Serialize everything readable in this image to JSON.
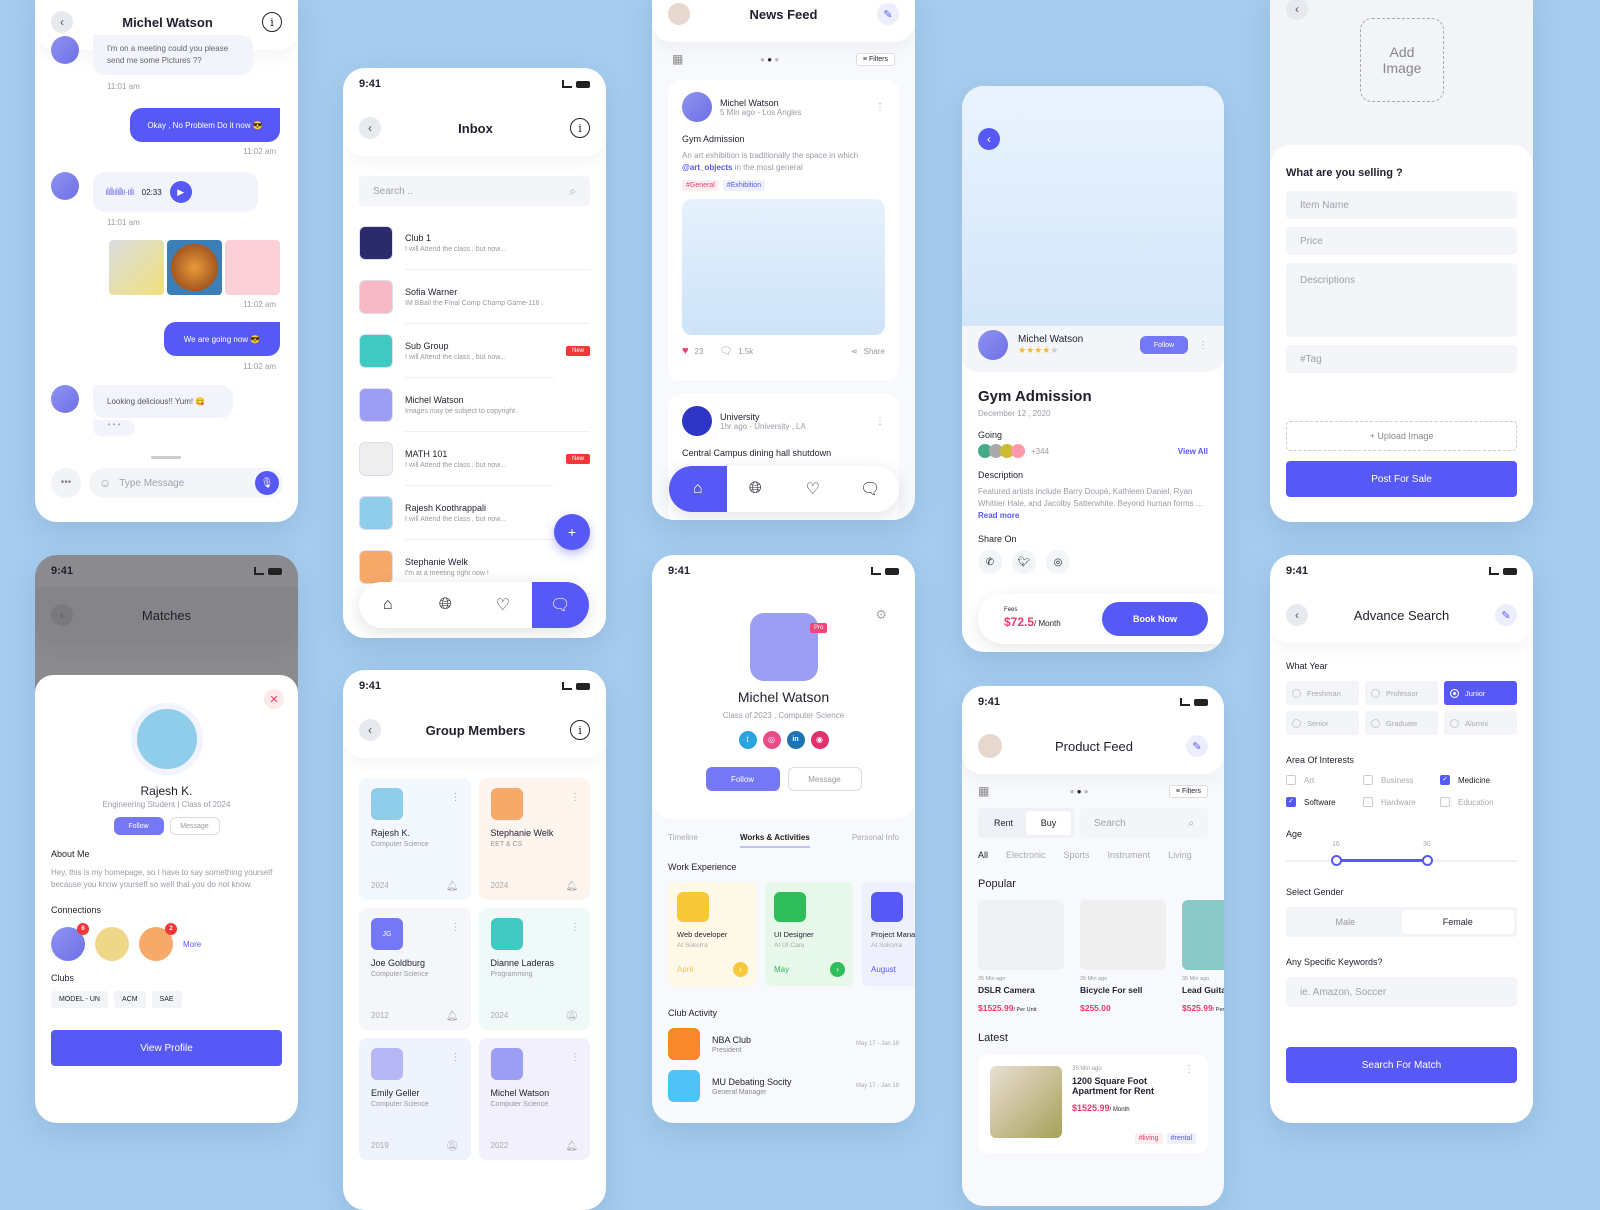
{
  "colors": {
    "primary": "#5659f6",
    "pink": "#f0386b",
    "background": "#a6cdee"
  },
  "status_time": "9:41",
  "chat": {
    "title": "Michel Watson",
    "messages": [
      {
        "from": "them",
        "text": "I'm on a meeting could you please send me some Pictures ??",
        "time": "11:01 am"
      },
      {
        "from": "me",
        "text": "Okay , No Problem Do it now 😎",
        "time": "11:02 am"
      },
      {
        "from": "them",
        "type": "voice",
        "duration": "02:33",
        "time": "11:01 am"
      },
      {
        "from": "me",
        "type": "images",
        "time": "11:02 am"
      },
      {
        "from": "me",
        "text": "We are going now 😎",
        "time": "11:02 am"
      },
      {
        "from": "them",
        "text": "Looking delicious!! Yum! 😋"
      }
    ],
    "input_placeholder": "Type Message"
  },
  "inbox": {
    "title": "Inbox",
    "search_placeholder": "Search ..",
    "items": [
      {
        "name": "Club 1",
        "verified": true,
        "preview": "I will Attend the class , but now...",
        "badge": ""
      },
      {
        "name": "Sofia Warner",
        "preview": "IM BBall the Final Comp Champ Game-116 .",
        "badge": ""
      },
      {
        "name": "Sub Group",
        "preview": "I will Attend the class , but now...",
        "badge": "New"
      },
      {
        "name": "Michel Watson",
        "preview": "Images may be subject to copyright.",
        "badge": ""
      },
      {
        "name": "MATH 101",
        "verified": true,
        "preview": "I will Attend the class , but now...",
        "badge": "New"
      },
      {
        "name": "Rajesh Koothrappali",
        "preview": "I will Attend the class , but now...",
        "badge": ""
      },
      {
        "name": "Stephanie Welk",
        "preview": "I'm at a meeting right now !",
        "badge": ""
      }
    ],
    "fab": "+"
  },
  "news": {
    "title": "News Feed",
    "filters": "Filters",
    "post1": {
      "author": "Michel Watson",
      "meta": "5 Min ago - Los Angles",
      "title": "Gym Admission",
      "body_pre": "An art exhibition is traditionally the space in which ",
      "mention": "@art_objects",
      "body_post": " in the most general",
      "tags": [
        "#General",
        "#Exhibition"
      ],
      "likes": "23",
      "comments": "1.5k",
      "share": "Share"
    },
    "post2": {
      "author": "University",
      "meta": "1hr ago - University , LA",
      "title": "Central Campus dining hall shutdown"
    }
  },
  "event": {
    "host": "Michel Watson",
    "rating": 4,
    "follow": "Follow",
    "title": "Gym Admission",
    "date": "December 12 , 2020",
    "going_label": "Going",
    "going_count": "+344",
    "view_all": "View All",
    "desc_label": "Description",
    "desc": "Featured artists include Barry Doupé, Kathleen Daniel, Ryan Whittier Hale, and Jacolby Satterwhite. Beyond human forms ... ",
    "read_more": "Read more",
    "share_label": "Share On",
    "fees_label": "Fees",
    "price": "$72.5",
    "per": "/ Month",
    "book": "Book Now"
  },
  "sell": {
    "add_image": "Add Image",
    "heading": "What are you selling ?",
    "fields": [
      "Item Name",
      "Price",
      "Descriptions",
      "#Tag"
    ],
    "upload": "+ Upload Image",
    "submit": "Post For Sale"
  },
  "matches": {
    "title": "Matches",
    "name": "Rajesh K.",
    "sub": "Engineering Student | Class of 2024",
    "follow": "Follow",
    "message": "Message",
    "about_label": "About Me",
    "about": "Hey, this is my homepage, so I have to say something yourself because you know yourself so well that you do not know.",
    "connections_label": "Connections",
    "connection_badges": [
      "6",
      "",
      "2"
    ],
    "more": "More",
    "clubs_label": "Clubs",
    "clubs": [
      "MODEL - UN",
      "ACM",
      "SAE"
    ],
    "view_profile": "View Profile"
  },
  "group": {
    "title": "Group Members",
    "members": [
      {
        "name": "Rajesh K.",
        "dept": "Computer Science",
        "year": "2024",
        "muted": false,
        "bg": "#f2f8fe"
      },
      {
        "name": "Stephanie Welk",
        "dept": "EET & CS",
        "year": "2024",
        "muted": false,
        "bg": "#fdf4ee"
      },
      {
        "name": "Joe Goldburg",
        "dept": "Computer Science",
        "year": "2012",
        "muted": false,
        "initials": "JG",
        "bg": "#f5f6f9"
      },
      {
        "name": "Dianne Laderas",
        "dept": "Programming",
        "year": "2024",
        "muted": true,
        "bg": "#eff9f8"
      },
      {
        "name": "Emily Geller",
        "dept": "Computer Science",
        "year": "2019",
        "muted": true,
        "bg": "#eef3fe"
      },
      {
        "name": "Michel Watson",
        "dept": "Computer Science",
        "year": "2022",
        "muted": false,
        "bg": "#f1f0fc"
      }
    ]
  },
  "profile": {
    "name": "Michel Watson",
    "badge": "Pro",
    "sub": "Class of 2023 , Computer Science",
    "follow": "Follow",
    "message": "Message",
    "tabs": [
      "Timeline",
      "Works & Activities",
      "Personal Info"
    ],
    "work_label": "Work Experience",
    "work": [
      {
        "title": "Web developer",
        "at": "At Sokorra",
        "month": "April",
        "color": "#f7c83a",
        "bg": "#fef8e6"
      },
      {
        "title": "UI Designer",
        "at": "At UI Care",
        "month": "May",
        "color": "#2fbe5b",
        "bg": "#e7f7ea"
      },
      {
        "title": "Project Manager",
        "at": "At Sokorra",
        "month": "August",
        "color": "#5659f6",
        "bg": "#eef0fd"
      }
    ],
    "club_label": "Club Activity",
    "clubs": [
      {
        "name": "NBA Club",
        "role": "President",
        "dates": "May 17 - Jan 18"
      },
      {
        "name": "MU Debating Socity",
        "role": "General Manager",
        "dates": "May 17 - Jan 18"
      }
    ]
  },
  "product": {
    "title": "Product Feed",
    "filters": "Filters",
    "toggle": [
      "Rent",
      "Buy"
    ],
    "search": "Search",
    "cats": [
      "All",
      "Electronic",
      "Sports",
      "Instrument",
      "Living"
    ],
    "popular_label": "Popular",
    "popular": [
      {
        "ago": "35 Min ago",
        "name": "DSLR Camera",
        "price": "$1525.99",
        "per": "/ Per Unit"
      },
      {
        "ago": "35 Min ago",
        "name": "Bicycle For sell",
        "price": "$255.00",
        "per": ""
      },
      {
        "ago": "35 Min ago",
        "name": "Lead Guitar",
        "price": "$525.99",
        "per": "/ Per Unit"
      }
    ],
    "latest_label": "Latest",
    "latest": {
      "ago": "35 Min ago",
      "name": "1200 Square Foot Apartment for Rent",
      "price": "$1525.99",
      "per": "/ Month",
      "tags": [
        "#living",
        "#rental"
      ]
    }
  },
  "search": {
    "title": "Advance Search",
    "year_label": "What Year",
    "years": [
      "Freshman",
      "Professor",
      "Junior",
      "Senior",
      "Graduate",
      "Alumni"
    ],
    "year_selected": "Junior",
    "interests_label": "Area Of Interests",
    "interests": [
      {
        "l": "Art",
        "c": false
      },
      {
        "l": "Business",
        "c": false
      },
      {
        "l": "Medicine",
        "c": true
      },
      {
        "l": "Software",
        "c": true
      },
      {
        "l": "Hardware",
        "c": false
      },
      {
        "l": "Education",
        "c": false
      }
    ],
    "age_label": "Age",
    "age_min": "16",
    "age_max": "30",
    "gender_label": "Select Gender",
    "genders": [
      "Male",
      "Female"
    ],
    "gender_selected": "Female",
    "kw_label": "Any Specific Keywords?",
    "kw_placeholder": "ie. Amazon, Soccer",
    "submit": "Search For Match"
  }
}
